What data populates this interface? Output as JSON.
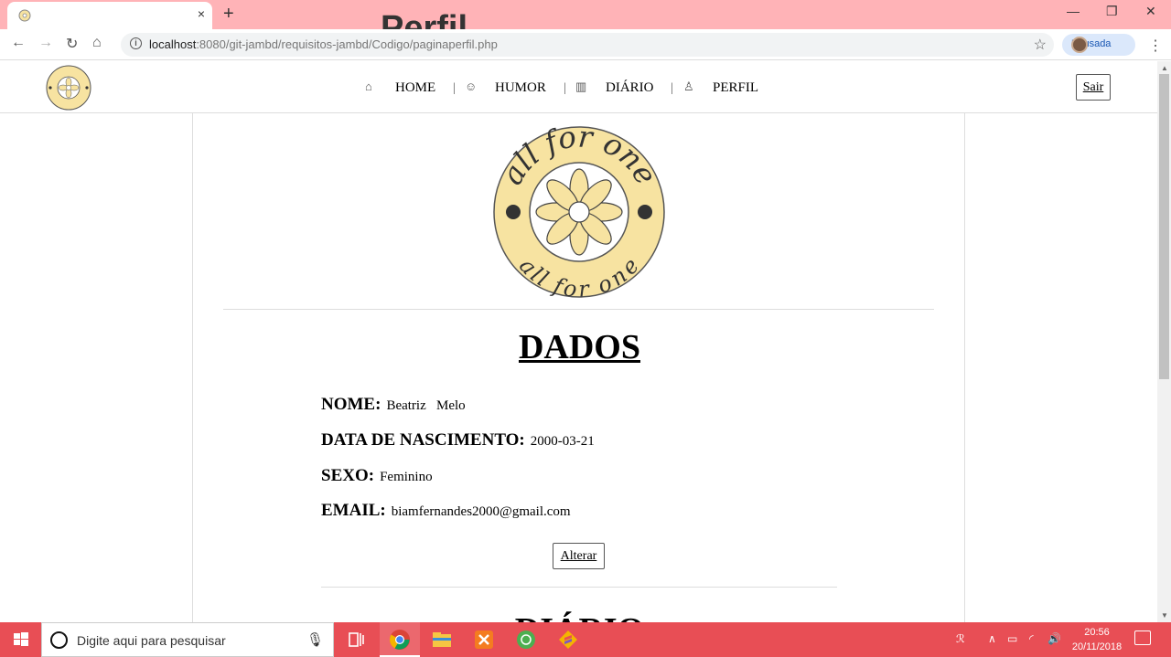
{
  "browser": {
    "tab_title": "Perfil",
    "tab_close": "×",
    "new_tab": "+",
    "url_host": "localhost",
    "url_rest": ":8080/git-jambd/requisitos-jambd/Codigo/paginaperfil.php",
    "profile_label": "Pausada",
    "info": "i"
  },
  "logo": {
    "text_top": "all for one",
    "text_bottom": "all for one"
  },
  "nav": {
    "items": [
      {
        "label": "HOME",
        "icon": "home-icon"
      },
      {
        "label": "HUMOR",
        "icon": "mood-icon"
      },
      {
        "label": "DIÁRIO",
        "icon": "diary-icon"
      },
      {
        "label": "PERFIL",
        "icon": "user-icon"
      }
    ],
    "separator": "|",
    "logout": "Sair"
  },
  "profile": {
    "title": "DADOS",
    "fields": [
      {
        "label": "NOME:",
        "value": "Beatriz   Melo"
      },
      {
        "label": "DATA DE NASCIMENTO:",
        "value": "2000-03-21"
      },
      {
        "label": "SEXO:",
        "value": "Feminino"
      },
      {
        "label": "EMAIL:",
        "value": "biamfernandes2000@gmail.com"
      }
    ],
    "edit_button": "Alterar",
    "next_section": "DIÁRIO"
  },
  "taskbar": {
    "search_placeholder": "Digite aqui para pesquisar",
    "time": "20:56",
    "date": "20/11/2018"
  },
  "colors": {
    "tabbar": "#ffb3b7",
    "taskbar": "#e84e55",
    "logo_fill": "#f7e3a1"
  }
}
